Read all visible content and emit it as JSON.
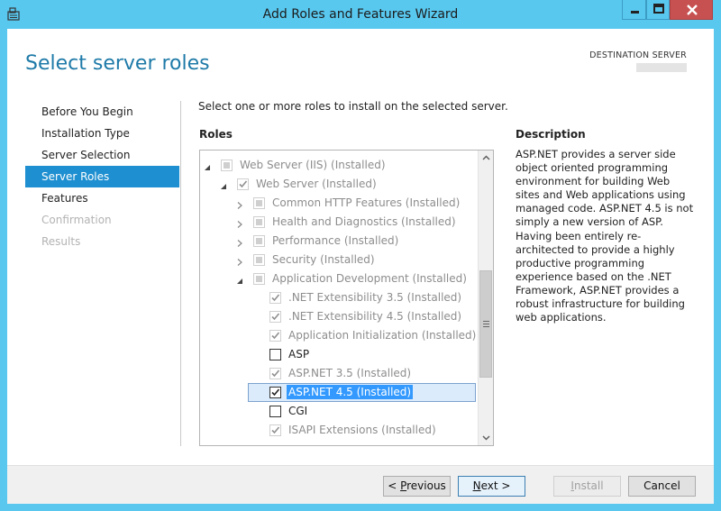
{
  "window": {
    "title": "Add Roles and Features Wizard"
  },
  "header": {
    "page_title": "Select server roles",
    "destination_label": "DESTINATION SERVER"
  },
  "nav": {
    "items": [
      {
        "label": "Before You Begin",
        "state": "normal"
      },
      {
        "label": "Installation Type",
        "state": "normal"
      },
      {
        "label": "Server Selection",
        "state": "normal"
      },
      {
        "label": "Server Roles",
        "state": "active"
      },
      {
        "label": "Features",
        "state": "normal"
      },
      {
        "label": "Confirmation",
        "state": "disabled"
      },
      {
        "label": "Results",
        "state": "disabled"
      }
    ]
  },
  "main": {
    "instruction": "Select one or more roles to install on the selected server.",
    "roles_label": "Roles",
    "tree": [
      {
        "label": "Web Server (IIS) (Installed)",
        "indent": 0,
        "expander": "expanded",
        "check": "partial",
        "enabled": false
      },
      {
        "label": "Web Server (Installed)",
        "indent": 1,
        "expander": "expanded",
        "check": "checked",
        "enabled": false
      },
      {
        "label": "Common HTTP Features (Installed)",
        "indent": 2,
        "expander": "collapsed",
        "check": "partial",
        "enabled": false
      },
      {
        "label": "Health and Diagnostics (Installed)",
        "indent": 2,
        "expander": "collapsed",
        "check": "partial",
        "enabled": false
      },
      {
        "label": "Performance (Installed)",
        "indent": 2,
        "expander": "collapsed",
        "check": "partial",
        "enabled": false
      },
      {
        "label": "Security (Installed)",
        "indent": 2,
        "expander": "collapsed",
        "check": "partial",
        "enabled": false
      },
      {
        "label": "Application Development (Installed)",
        "indent": 2,
        "expander": "expanded",
        "check": "partial",
        "enabled": false
      },
      {
        "label": ".NET Extensibility 3.5 (Installed)",
        "indent": 3,
        "expander": "none",
        "check": "checked",
        "enabled": false
      },
      {
        "label": ".NET Extensibility 4.5 (Installed)",
        "indent": 3,
        "expander": "none",
        "check": "checked",
        "enabled": false
      },
      {
        "label": "Application Initialization (Installed)",
        "indent": 3,
        "expander": "none",
        "check": "checked",
        "enabled": false
      },
      {
        "label": "ASP",
        "indent": 3,
        "expander": "none",
        "check": "unchecked",
        "enabled": true
      },
      {
        "label": "ASP.NET 3.5 (Installed)",
        "indent": 3,
        "expander": "none",
        "check": "checked",
        "enabled": false
      },
      {
        "label": "ASP.NET 4.5 (Installed)",
        "indent": 3,
        "expander": "none",
        "check": "checked",
        "enabled": true,
        "selected": true
      },
      {
        "label": "CGI",
        "indent": 3,
        "expander": "none",
        "check": "unchecked",
        "enabled": true
      },
      {
        "label": "ISAPI Extensions (Installed)",
        "indent": 3,
        "expander": "none",
        "check": "checked",
        "enabled": false
      }
    ]
  },
  "description": {
    "label": "Description",
    "text": "ASP.NET provides a server side object oriented programming environment for building Web sites and Web applications using managed code. ASP.NET 4.5 is not simply a new version of ASP. Having been entirely re-architected to provide a highly productive programming experience based on the .NET Framework, ASP.NET provides a robust infrastructure for building web applications."
  },
  "footer": {
    "previous": {
      "prefix": "< ",
      "mnemonic": "P",
      "rest": "revious"
    },
    "next": {
      "mnemonic": "N",
      "rest": "ext",
      "suffix": " >"
    },
    "install": {
      "mnemonic": "I",
      "rest": "nstall"
    },
    "cancel": "Cancel"
  },
  "colors": {
    "titlebar": "#59c8ef",
    "accent": "#1e7aa8",
    "nav_active": "#1e8fd0",
    "close_button": "#c75050",
    "selection_highlight": "#3399ff"
  },
  "icons": [
    "app-icon",
    "minimize-icon",
    "maximize-icon",
    "close-icon",
    "expand-arrow-icon",
    "collapse-arrow-icon",
    "checkbox",
    "scroll-up-icon",
    "scroll-down-icon"
  ]
}
